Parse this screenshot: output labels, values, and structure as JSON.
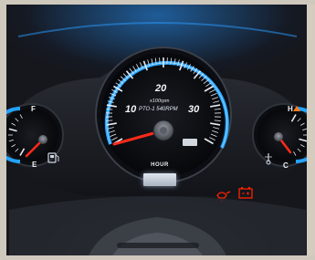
{
  "speedometer": {
    "scale_labels": [
      "10",
      "20",
      "30"
    ],
    "unit_text": "x100rpm",
    "pto_text": "PTO-1 540RPM"
  },
  "fuel_gauge": {
    "full_label": "F",
    "empty_label": "E"
  },
  "temp_gauge": {
    "hot_label": "H",
    "cold_label": "C"
  },
  "hour_meter": {
    "label": "HOUR"
  },
  "colors": {
    "backlight": "#2a9bff",
    "needle": "#ff2a1a",
    "warning": "#ff2200"
  }
}
